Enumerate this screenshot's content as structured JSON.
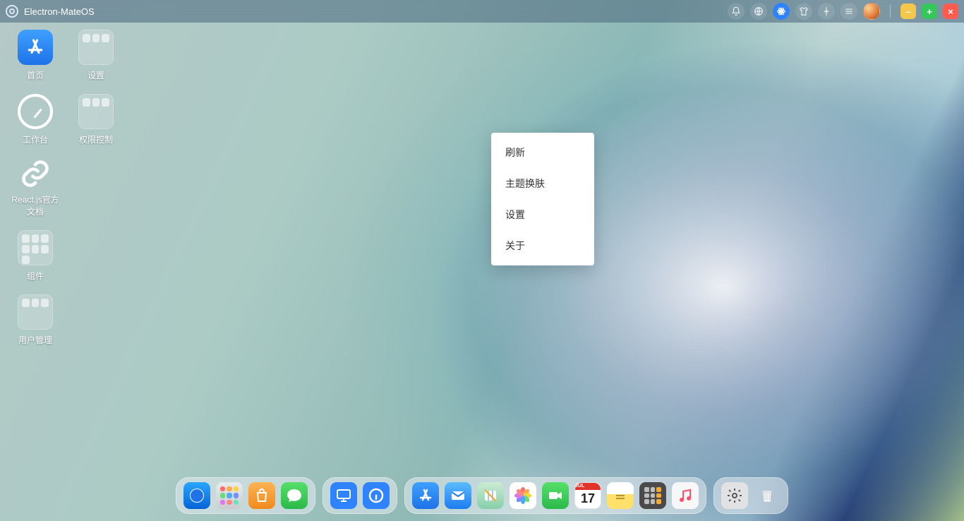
{
  "topbar": {
    "title": "Electron-MateOS",
    "tray": [
      {
        "name": "bell-icon",
        "accent": false
      },
      {
        "name": "globe-icon",
        "accent": false
      },
      {
        "name": "atom-icon",
        "accent": true
      },
      {
        "name": "shirt-icon",
        "accent": false
      },
      {
        "name": "pin-icon",
        "accent": false
      },
      {
        "name": "lines-icon",
        "accent": false
      }
    ]
  },
  "desktop_icons": [
    {
      "name": "home",
      "kind": "tile",
      "label": "首页"
    },
    {
      "name": "settings-folder",
      "kind": "folder",
      "label": "设置"
    },
    {
      "name": "workbench",
      "kind": "dash",
      "label": "工作台"
    },
    {
      "name": "permission-folder",
      "kind": "folder",
      "label": "权限控制"
    },
    {
      "name": "react-docs",
      "kind": "link",
      "label": "React.js官方文档"
    },
    {
      "name": "empty-1",
      "kind": "none",
      "label": ""
    },
    {
      "name": "components-folder",
      "kind": "folder2",
      "label": "组件"
    },
    {
      "name": "empty-2",
      "kind": "none",
      "label": ""
    },
    {
      "name": "user-mgmt-folder",
      "kind": "folder",
      "label": "用户管理"
    }
  ],
  "context_menu": {
    "items": [
      {
        "name": "refresh",
        "label": "刷新"
      },
      {
        "name": "theme",
        "label": "主题换肤"
      },
      {
        "name": "settings",
        "label": "设置"
      },
      {
        "name": "about",
        "label": "关于"
      }
    ]
  },
  "dock": {
    "calendar_month": "JUL",
    "calendar_day": "17",
    "groups": [
      [
        {
          "name": "safari",
          "class": "c-safari"
        },
        {
          "name": "launchpad",
          "class": "c-lp"
        },
        {
          "name": "bag",
          "class": "c-orange"
        },
        {
          "name": "messages",
          "class": "c-msg"
        }
      ],
      [
        {
          "name": "display",
          "class": "c-display"
        },
        {
          "name": "info",
          "class": "c-info"
        }
      ],
      [
        {
          "name": "appstore",
          "class": "c-appstore"
        },
        {
          "name": "mail",
          "class": "c-mail"
        },
        {
          "name": "maps",
          "class": "c-maps"
        },
        {
          "name": "photos",
          "class": "c-photos"
        },
        {
          "name": "facetime",
          "class": "c-ft"
        },
        {
          "name": "calendar",
          "class": "c-cal"
        },
        {
          "name": "notes",
          "class": "c-notes"
        },
        {
          "name": "calculator",
          "class": "c-calc"
        },
        {
          "name": "music",
          "class": "c-music"
        }
      ],
      [
        {
          "name": "system-settings",
          "class": "c-settings"
        },
        {
          "name": "trash",
          "class": "c-trash"
        }
      ]
    ]
  }
}
